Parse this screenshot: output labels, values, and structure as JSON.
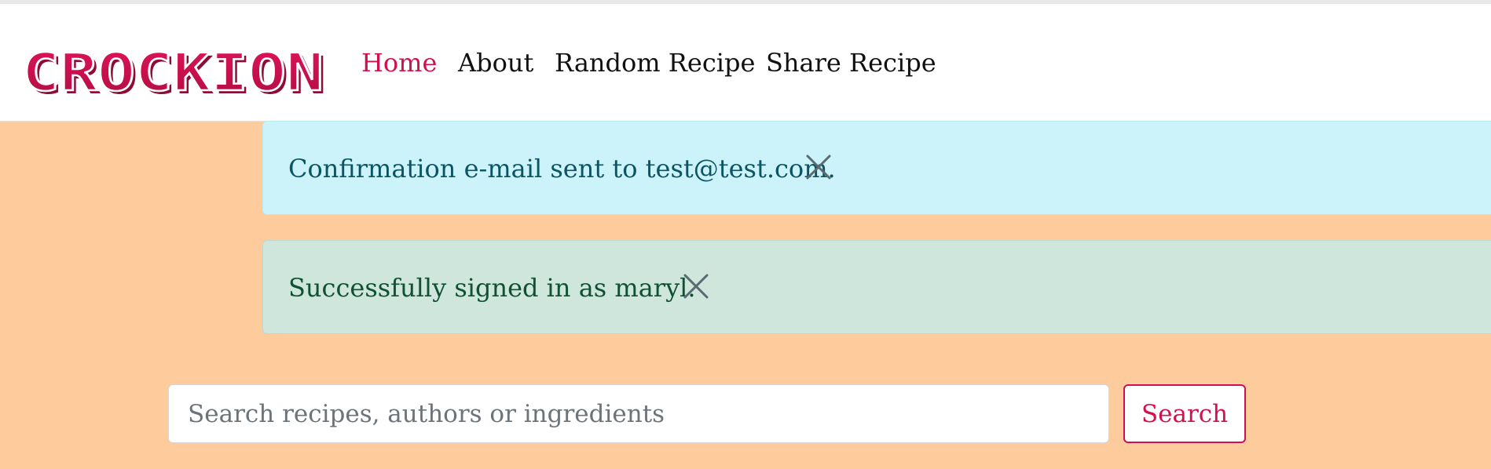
{
  "brand": {
    "logo_text": "CROCKION",
    "color": "#d1114e"
  },
  "nav": {
    "items": [
      {
        "label": "Home",
        "active": true
      },
      {
        "label": "About",
        "active": false
      },
      {
        "label": "Random Recipe",
        "active": false
      },
      {
        "label": "Share Recipe",
        "active": false
      }
    ]
  },
  "alerts": {
    "info": {
      "message": "Confirmation e-mail sent to test@test.com.",
      "icon": "close-icon",
      "color": "#ccf3fa"
    },
    "success": {
      "message": "Successfully signed in as maryl.",
      "icon": "close-icon",
      "color": "#cfe6dd"
    }
  },
  "search": {
    "placeholder": "Search recipes, authors or ingredients",
    "value": "",
    "button_label": "Search"
  },
  "colors": {
    "page_background": "#fecb9c",
    "accent": "#d1114e"
  }
}
